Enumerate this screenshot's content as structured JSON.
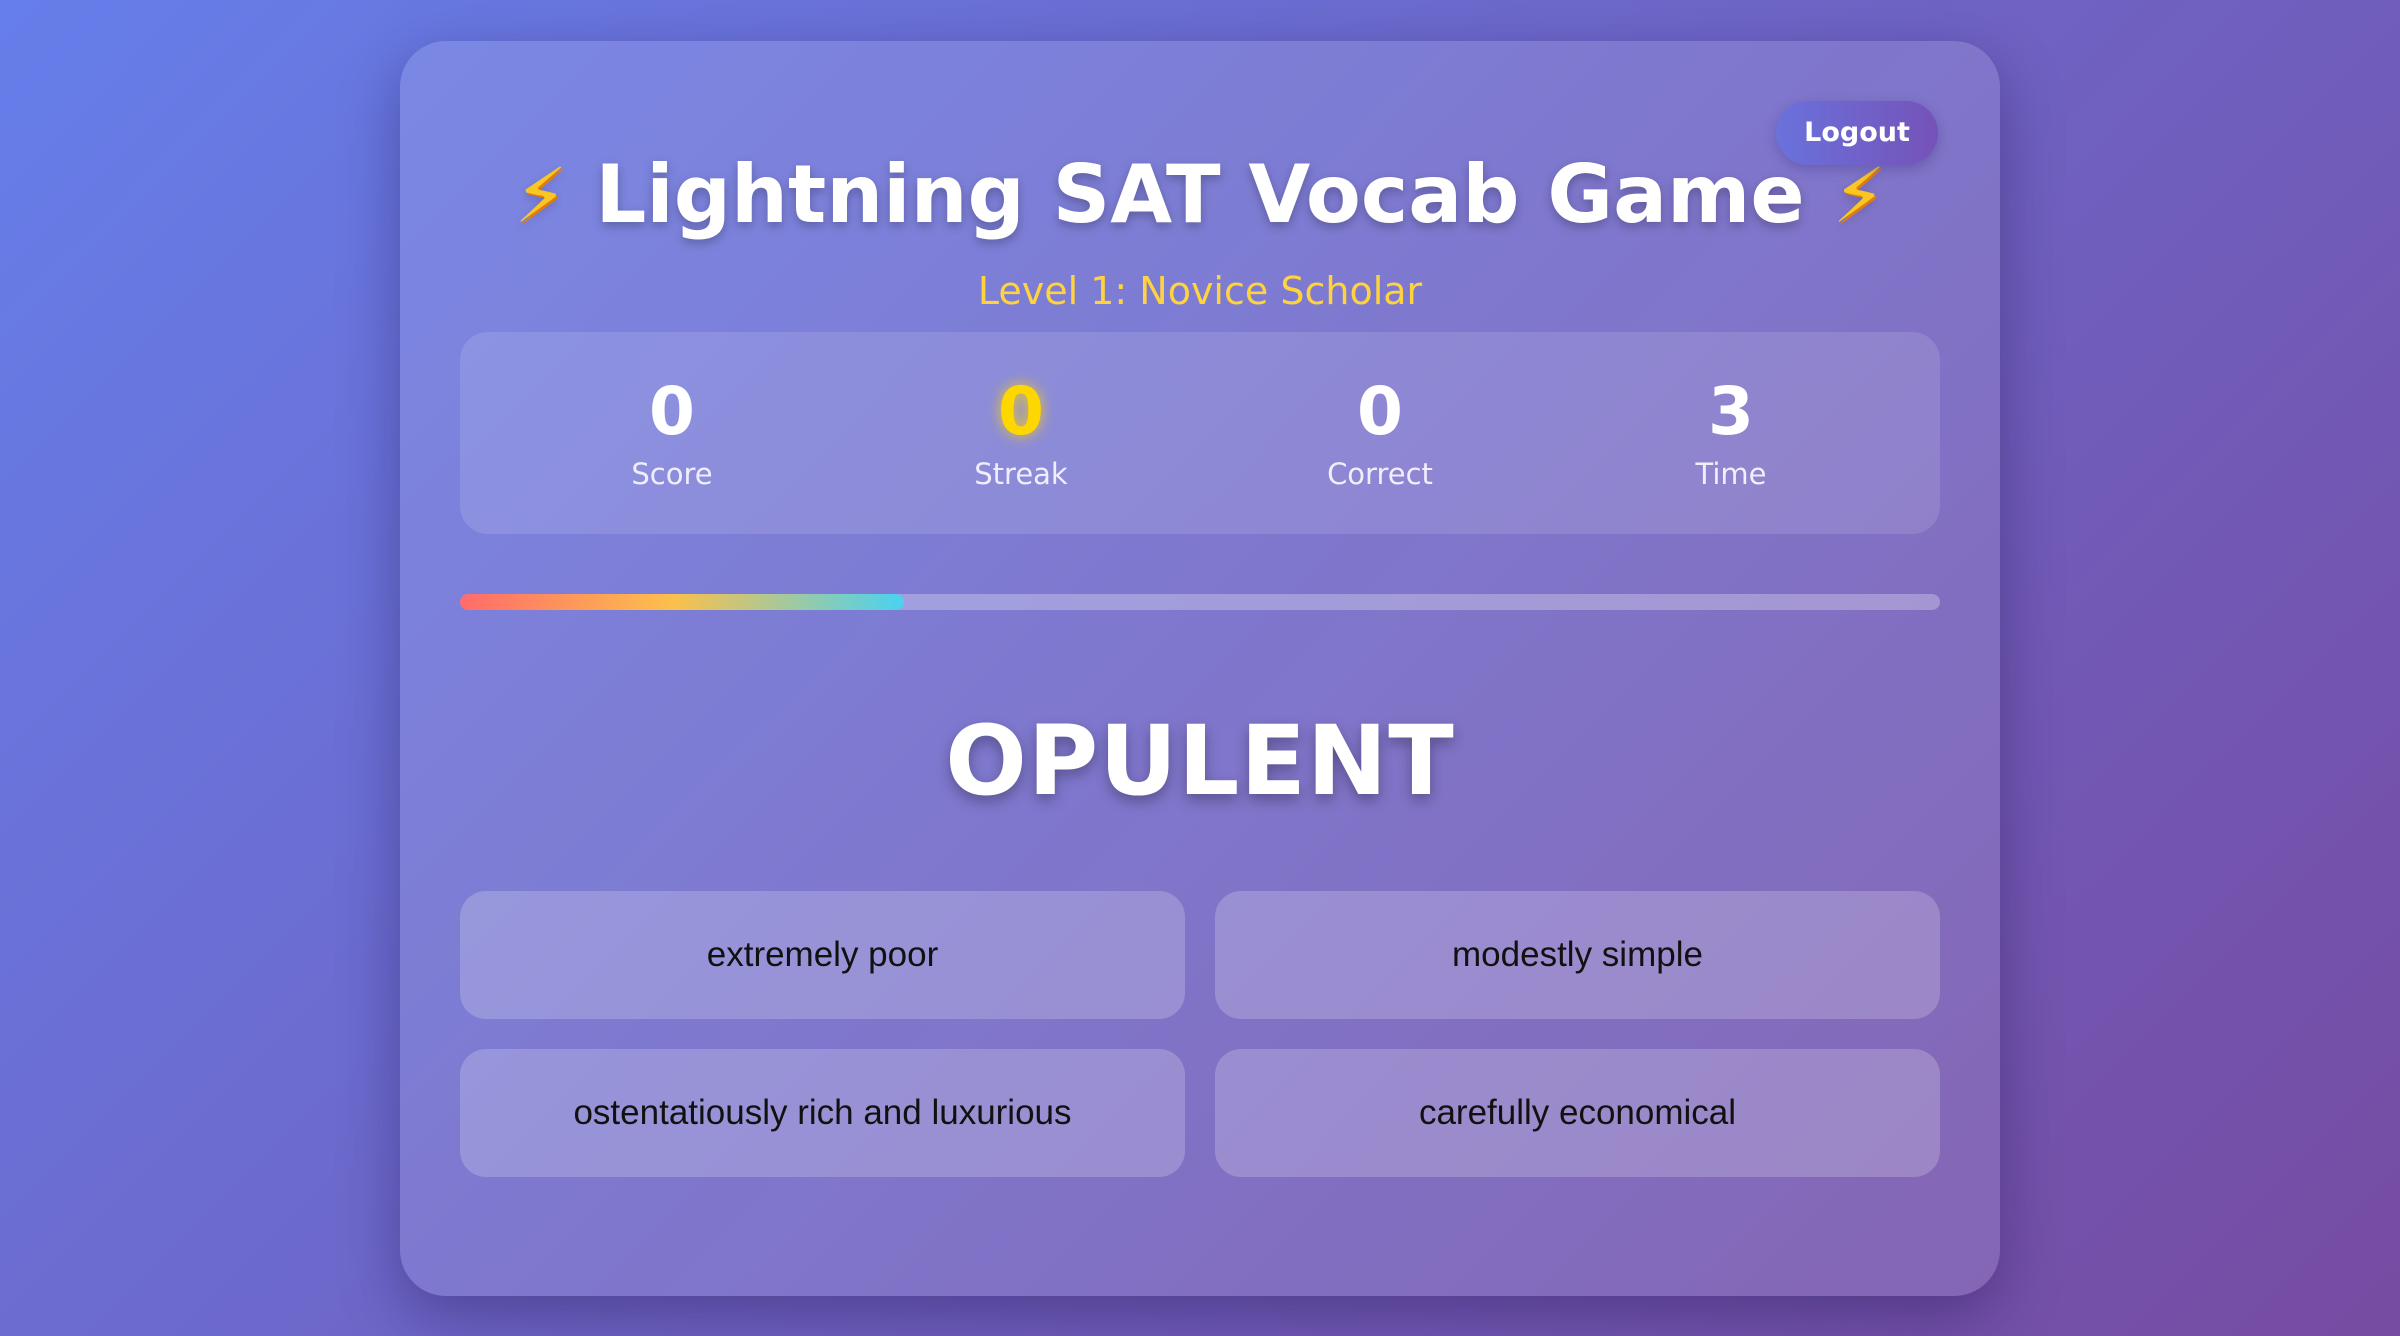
{
  "header": {
    "title": "Lightning SAT Vocab Game",
    "title_icon": "lightning-bolt-icon",
    "level": "Level 1: Novice Scholar",
    "logout_label": "Logout"
  },
  "stats": [
    {
      "value": "0",
      "label": "Score"
    },
    {
      "value": "0",
      "label": "Streak"
    },
    {
      "value": "0",
      "label": "Correct"
    },
    {
      "value": "3",
      "label": "Time"
    }
  ],
  "progress": {
    "fraction": 0.3
  },
  "question": {
    "word": "OPULENT"
  },
  "options": [
    "extremely poor",
    "modestly simple",
    "ostentatiously rich and luxurious",
    "carefully economical"
  ],
  "colors": {
    "background_start": "#667eea",
    "background_end": "#764ba2",
    "level_text": "#ffd33d",
    "streak_value": "#ffd700",
    "progress_start": "#ff6b6b",
    "progress_mid": "#fbc04c",
    "progress_end": "#49d2f0"
  }
}
